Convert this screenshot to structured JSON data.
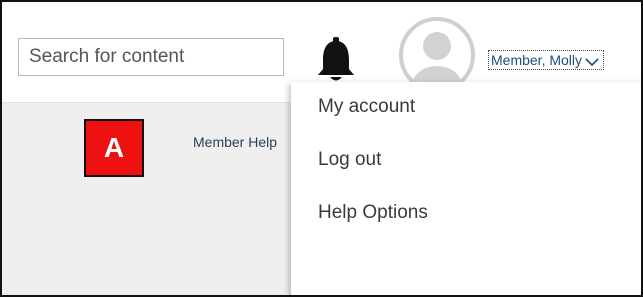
{
  "header": {
    "search": {
      "placeholder": "Search for content",
      "value": ""
    },
    "bell_icon": "bell-icon",
    "avatar_icon": "user-avatar-icon",
    "user_menu": {
      "label": "Member, Molly",
      "icon": "chevron-down-icon"
    }
  },
  "annotation": {
    "badge_label": "A",
    "badge_color": "#ee1111"
  },
  "main": {
    "help_link": "Member Help"
  },
  "dropdown": {
    "items": [
      {
        "label": "My account"
      },
      {
        "label": "Log out"
      },
      {
        "label": "Help Options"
      }
    ]
  }
}
